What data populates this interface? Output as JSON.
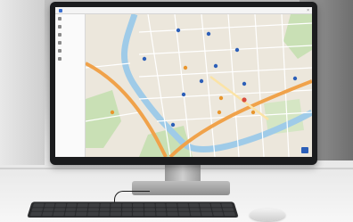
{
  "app": {
    "title": "",
    "close_glyph": "×"
  },
  "sidebar": {
    "items": [
      {
        "icon": "home-icon",
        "label": ""
      },
      {
        "icon": "layers-icon",
        "label": ""
      },
      {
        "icon": "route-icon",
        "label": ""
      },
      {
        "icon": "pin-icon",
        "label": ""
      },
      {
        "icon": "list-icon",
        "label": ""
      },
      {
        "icon": "settings-icon",
        "label": ""
      }
    ]
  },
  "map": {
    "footer_button_label": "",
    "colors": {
      "land": "#ece7dc",
      "park": "#c9e0b5",
      "water": "#9fcbe8",
      "highway": "#f0a24a",
      "road": "#ffffff",
      "marker_blue": "#2c5fb8",
      "marker_red": "#d94c3d",
      "marker_orange": "#e9962d"
    }
  }
}
